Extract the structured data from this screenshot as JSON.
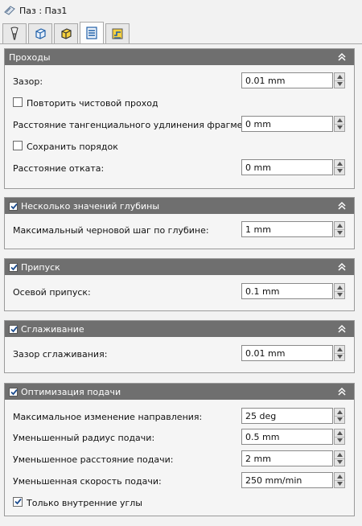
{
  "window": {
    "title": "Паз : Паз1"
  },
  "tabs": [
    {
      "icon": "tool-icon"
    },
    {
      "icon": "cube-rotate-icon"
    },
    {
      "icon": "cube-yellow-icon"
    },
    {
      "icon": "passes-list-icon",
      "active": true
    },
    {
      "icon": "linking-icon"
    }
  ],
  "passes": {
    "header": "Проходы",
    "gap_label": "Зазор:",
    "gap_value": "0.01 mm",
    "repeat_finish_label": "Повторить чистовой проход",
    "tangent_ext_label": "Расстояние тангенциального удлинения фрагмента:",
    "tangent_ext_value": "0 mm",
    "keep_order_label": "Сохранить порядок",
    "retract_label": "Расстояние отката:",
    "retract_value": "0 mm"
  },
  "depth": {
    "header": "Несколько значений глубины",
    "rough_step_label": "Максимальный черновой шаг по глубине:",
    "rough_step_value": "1 mm"
  },
  "allowance": {
    "header": "Припуск",
    "axial_label": "Осевой припуск:",
    "axial_value": "0.1 mm"
  },
  "smoothing": {
    "header": "Сглаживание",
    "gap_label": "Зазор сглаживания:",
    "gap_value": "0.01 mm"
  },
  "feed_opt": {
    "header": "Оптимизация подачи",
    "max_dir_label": "Максимальное изменение направления:",
    "max_dir_value": "25 deg",
    "red_radius_label": "Уменьшенный радиус подачи:",
    "red_radius_value": "0.5 mm",
    "red_dist_label": "Уменьшенное расстояние подачи:",
    "red_dist_value": "2 mm",
    "red_speed_label": "Уменьшенная скорость подачи:",
    "red_speed_value": "250 mm/min",
    "inner_corners_label": "Только внутренние углы"
  }
}
